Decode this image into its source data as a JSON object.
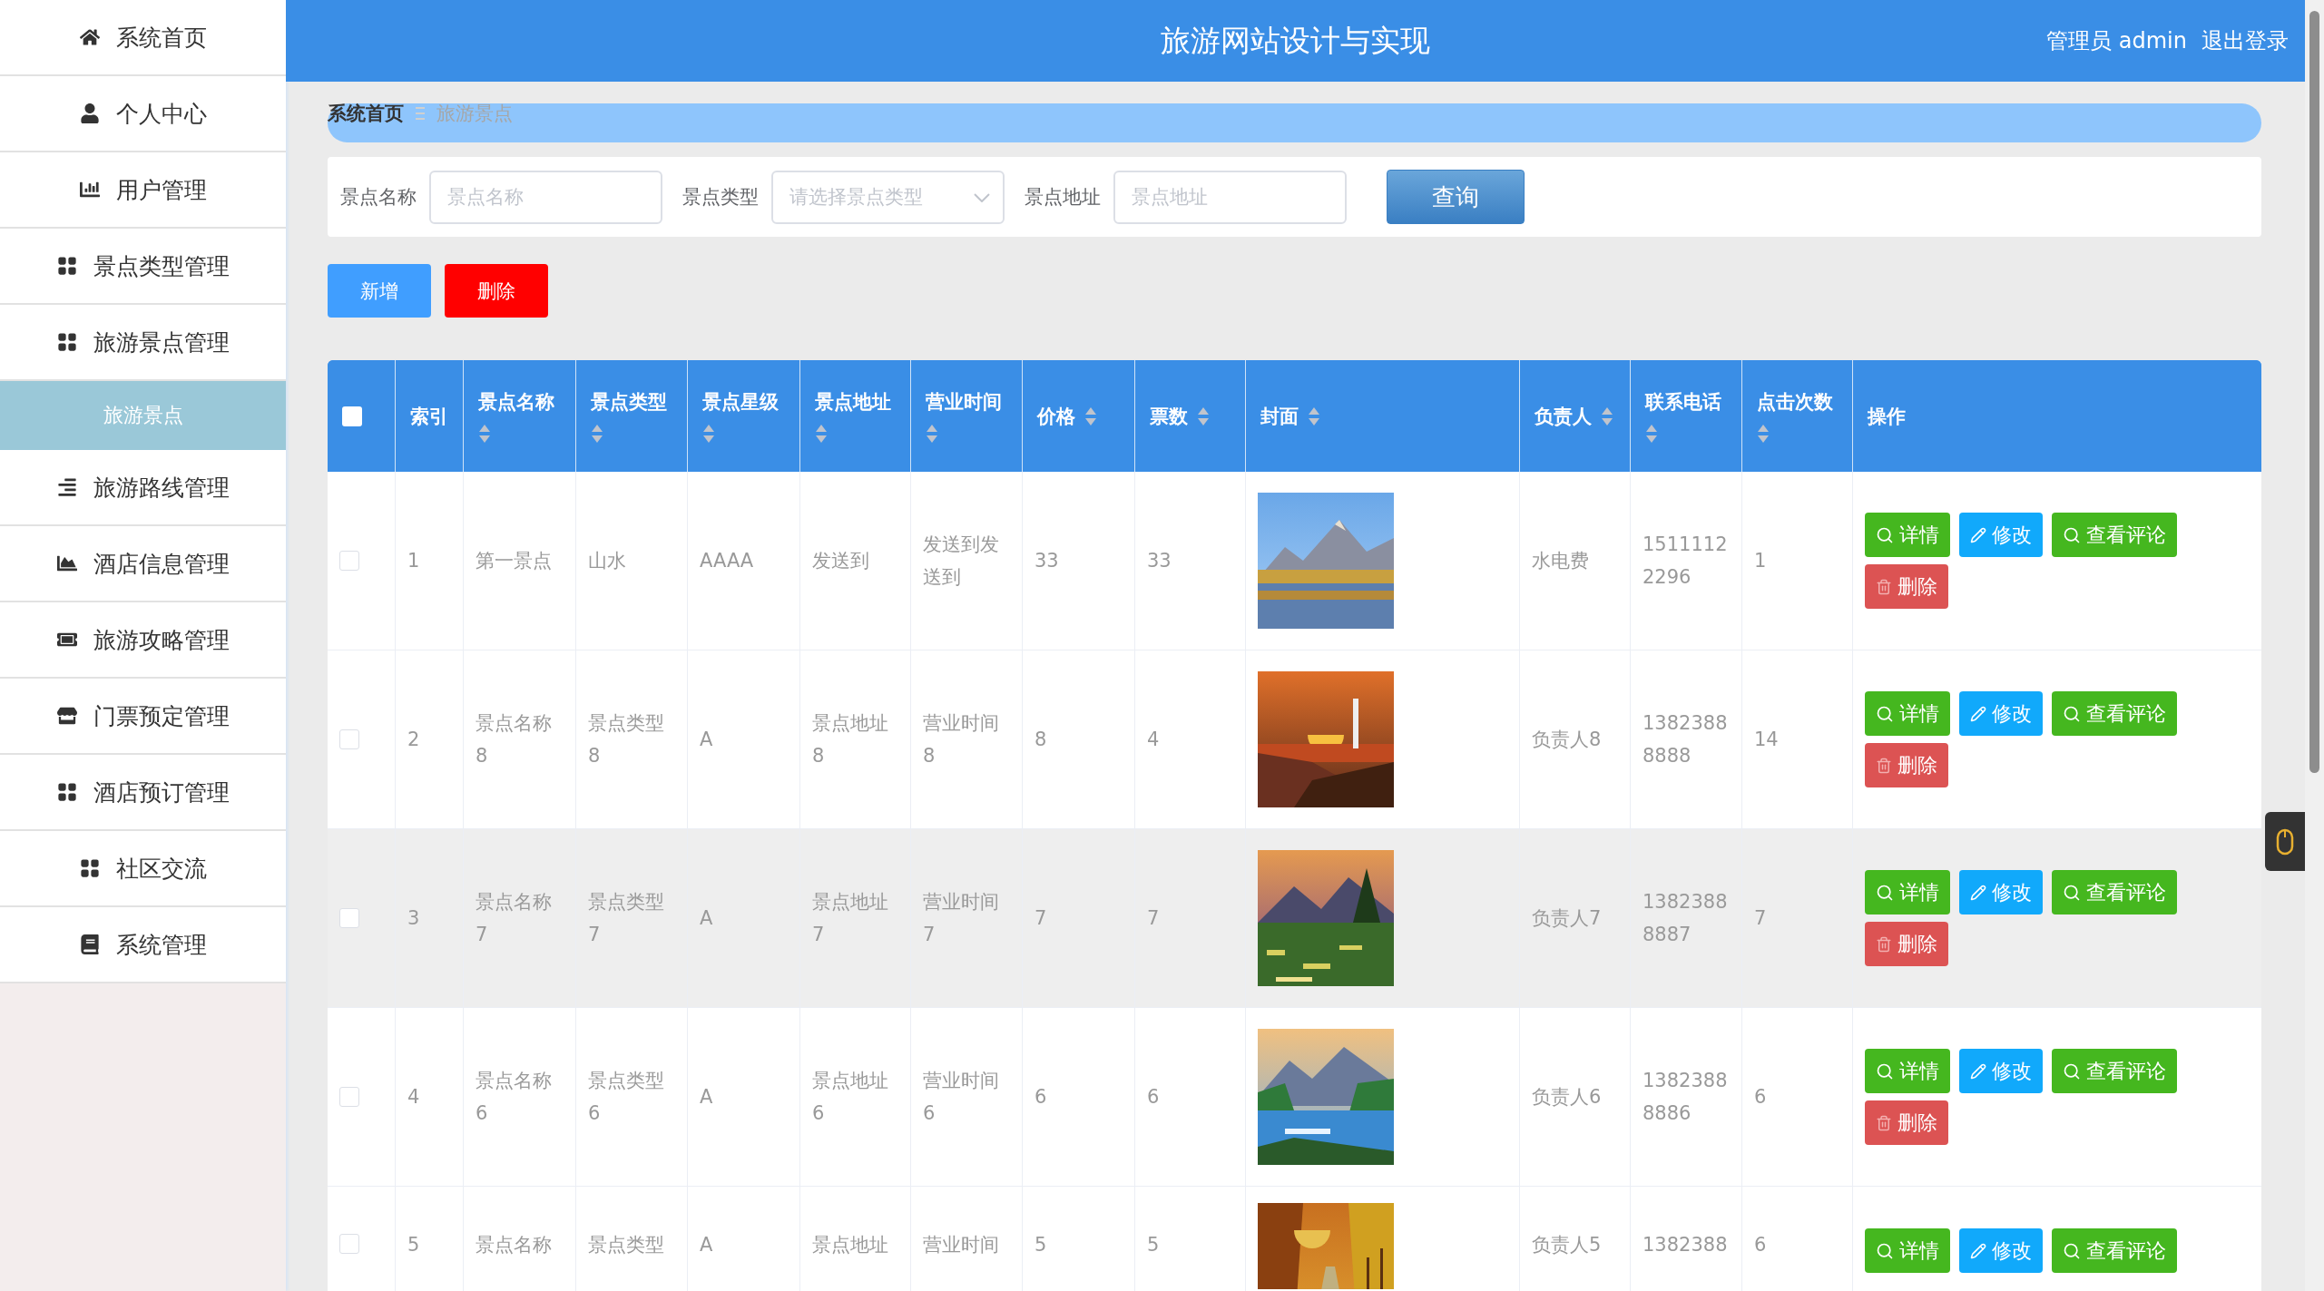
{
  "sidebar": {
    "items": [
      {
        "label": "系统首页",
        "selected": false
      },
      {
        "label": "个人中心",
        "selected": false
      },
      {
        "label": "用户管理",
        "selected": false
      },
      {
        "label": "景点类型管理",
        "selected": false
      },
      {
        "label": "旅游景点管理",
        "selected": false,
        "expanded": true,
        "children": [
          {
            "label": "旅游景点",
            "selected": true
          }
        ]
      },
      {
        "label": "旅游路线管理",
        "selected": false
      },
      {
        "label": "酒店信息管理",
        "selected": false
      },
      {
        "label": "旅游攻略管理",
        "selected": false
      },
      {
        "label": "门票预定管理",
        "selected": false
      },
      {
        "label": "酒店预订管理",
        "selected": false
      },
      {
        "label": "社区交流",
        "selected": false
      },
      {
        "label": "系统管理",
        "selected": false
      }
    ]
  },
  "header": {
    "title": "旅游网站设计与实现",
    "user": "管理员 admin",
    "logout": "退出登录"
  },
  "breadcrumb": [
    "系统首页",
    "旅游景点"
  ],
  "search": {
    "fields": [
      {
        "label": "景点名称",
        "placeholder": "景点名称",
        "kind": "input"
      },
      {
        "label": "景点类型",
        "placeholder": "请选择景点类型",
        "kind": "select"
      },
      {
        "label": "景点地址",
        "placeholder": "景点地址",
        "kind": "input"
      }
    ],
    "button": "查询"
  },
  "actions": [
    {
      "label": "新增",
      "kind": "add"
    },
    {
      "label": "删除",
      "kind": "delete"
    }
  ],
  "table": {
    "select_all": {
      "checked": false
    },
    "columns": [
      {
        "label": "索引",
        "sortable": false
      },
      {
        "label": "景点名称",
        "sortable": true
      },
      {
        "label": "景点类型",
        "sortable": true
      },
      {
        "label": "景点星级",
        "sortable": true
      },
      {
        "label": "景点地址",
        "sortable": true
      },
      {
        "label": "营业时间",
        "sortable": true
      },
      {
        "label": "价格",
        "sortable": true
      },
      {
        "label": "票数",
        "sortable": true
      },
      {
        "label": "封面",
        "sortable": true
      },
      {
        "label": "负责人",
        "sortable": true
      },
      {
        "label": "联系电话",
        "sortable": true
      },
      {
        "label": "点击次数",
        "sortable": true
      },
      {
        "label": "操作",
        "sortable": false
      }
    ],
    "rows": [
      {
        "checked": false,
        "highlighted": false,
        "cells": [
          "1",
          "第一景点",
          "山水",
          "AAAA",
          "发送到",
          "发送到发送到",
          "33",
          "33",
          {
            "kind": "picture"
          },
          "水电费",
          "15111122296",
          "1"
        ],
        "buttons": [
          {
            "label": "详情",
            "kind": "detail"
          },
          {
            "label": "修改",
            "kind": "edit"
          },
          {
            "label": "查看评论",
            "kind": "detail"
          },
          {
            "label": "删除",
            "kind": "delete"
          }
        ]
      },
      {
        "checked": false,
        "highlighted": false,
        "cells": [
          "2",
          "景点名称8",
          "景点类型8",
          "A",
          "景点地址8",
          "营业时间8",
          "8",
          "4",
          {
            "kind": "picture"
          },
          "负责人8",
          "13823888888",
          "14"
        ],
        "buttons": [
          {
            "label": "详情",
            "kind": "detail"
          },
          {
            "label": "修改",
            "kind": "edit"
          },
          {
            "label": "查看评论",
            "kind": "detail"
          },
          {
            "label": "删除",
            "kind": "delete"
          }
        ]
      },
      {
        "checked": false,
        "highlighted": true,
        "cells": [
          "3",
          "景点名称7",
          "景点类型7",
          "A",
          "景点地址7",
          "营业时间7",
          "7",
          "7",
          {
            "kind": "picture"
          },
          "负责人7",
          "13823888887",
          "7"
        ],
        "buttons": [
          {
            "label": "详情",
            "kind": "detail"
          },
          {
            "label": "修改",
            "kind": "edit"
          },
          {
            "label": "查看评论",
            "kind": "detail"
          },
          {
            "label": "删除",
            "kind": "delete"
          }
        ]
      },
      {
        "checked": false,
        "highlighted": false,
        "cells": [
          "4",
          "景点名称6",
          "景点类型6",
          "A",
          "景点地址6",
          "营业时间6",
          "6",
          "6",
          {
            "kind": "picture"
          },
          "负责人6",
          "13823888886",
          "6"
        ],
        "buttons": [
          {
            "label": "详情",
            "kind": "detail"
          },
          {
            "label": "修改",
            "kind": "edit"
          },
          {
            "label": "查看评论",
            "kind": "detail"
          },
          {
            "label": "删除",
            "kind": "delete"
          }
        ]
      },
      {
        "checked": false,
        "highlighted": false,
        "cells": [
          "5",
          "景点名称",
          "景点类型",
          "A",
          "景点地址",
          "营业时间",
          "5",
          "5",
          {
            "kind": "picture"
          },
          "负责人5",
          "1382388",
          "6"
        ],
        "buttons": [
          {
            "label": "详情",
            "kind": "detail"
          },
          {
            "label": "修改",
            "kind": "edit"
          },
          {
            "label": "查看评论",
            "kind": "detail"
          }
        ]
      }
    ]
  }
}
